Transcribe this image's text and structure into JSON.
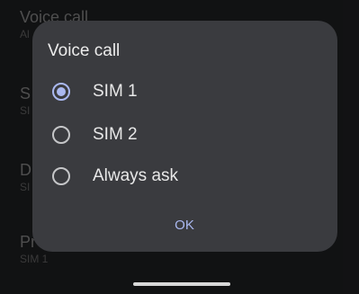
{
  "background_list": {
    "items": [
      {
        "title": "Voice call",
        "subtitle": "Al"
      },
      {
        "title": "S",
        "subtitle": "SI"
      },
      {
        "title": "D",
        "subtitle": "SI"
      },
      {
        "title": "Pr",
        "subtitle": "SIM 1"
      }
    ]
  },
  "dialog": {
    "title": "Voice call",
    "options": [
      {
        "label": "SIM 1",
        "selected": true
      },
      {
        "label": "SIM 2",
        "selected": false
      },
      {
        "label": "Always ask",
        "selected": false
      }
    ],
    "ok_label": "OK"
  },
  "colors": {
    "accent": "#aab8f0",
    "dialog_bg": "#3a3b3f"
  }
}
